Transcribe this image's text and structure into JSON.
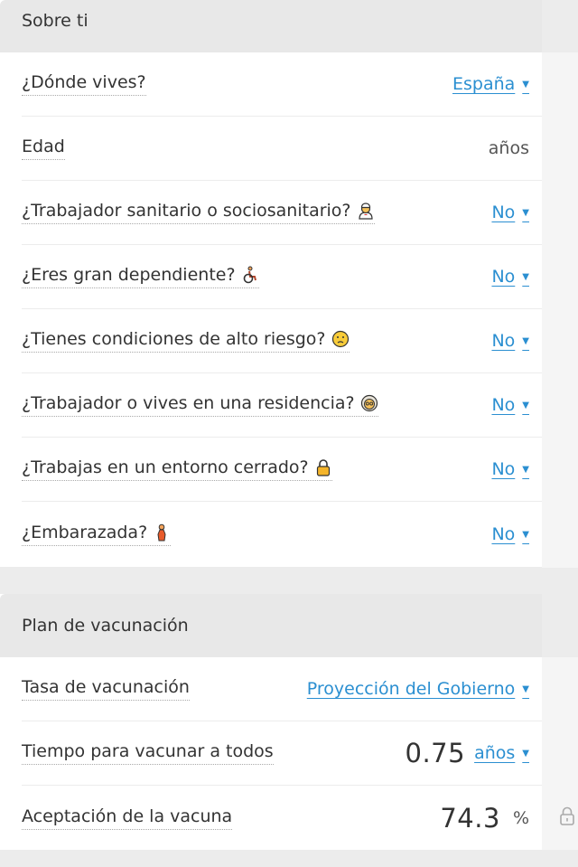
{
  "sections": {
    "about": {
      "title": "Sobre ti",
      "rows": [
        {
          "label": "¿Dónde vives?",
          "value": "España"
        },
        {
          "label": "Edad",
          "unit": "años"
        },
        {
          "label": "¿Trabajador sanitario o sociosanitario?",
          "icon": "health-worker-icon",
          "value": "No"
        },
        {
          "label": "¿Eres gran dependiente?",
          "icon": "wheelchair-icon",
          "value": "No"
        },
        {
          "label": "¿Tienes condiciones de alto riesgo?",
          "icon": "worried-face-icon",
          "value": "No"
        },
        {
          "label": "¿Trabajador o vives en una residencia?",
          "icon": "elderly-woman-icon",
          "value": "No"
        },
        {
          "label": "¿Trabajas en un entorno cerrado?",
          "icon": "padlock-icon",
          "value": "No"
        },
        {
          "label": "¿Embarazada?",
          "icon": "pregnant-woman-icon",
          "value": "No"
        }
      ]
    },
    "plan": {
      "title": "Plan de vacunación",
      "rows": [
        {
          "label": "Tasa de vacunación",
          "value": "Proyección del Gobierno"
        },
        {
          "label": "Tiempo para vacunar a todos",
          "number": "0.75",
          "value": "años"
        },
        {
          "label": "Aceptación de la vacuna",
          "number": "74.3",
          "unit": "%",
          "icon": "lock-icon"
        }
      ]
    }
  },
  "colors": {
    "link": "#2b8fd1",
    "header_bg": "#e8e8e8",
    "page_bg": "#ececec"
  }
}
